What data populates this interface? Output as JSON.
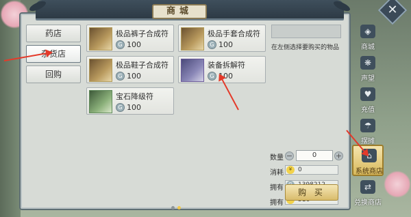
{
  "window": {
    "title": "商城"
  },
  "categories": [
    {
      "label": "药店"
    },
    {
      "label": "杂货店"
    },
    {
      "label": "回购"
    }
  ],
  "items": [
    {
      "name": "极品裤子合成符",
      "price": "100"
    },
    {
      "name": "极品手套合成符",
      "price": "100"
    },
    {
      "name": "极品鞋子合成符",
      "price": "100"
    },
    {
      "name": "装备拆解符",
      "price": "100"
    },
    {
      "name": "宝石降级符",
      "price": "100"
    }
  ],
  "detail": {
    "hint": "在左侧选择要购买的物品",
    "quantity_label": "数量",
    "quantity_value": "0",
    "cost_label": "消耗",
    "cost_value": "0",
    "owned_label_1": "拥有",
    "owned_value_1": "1398212",
    "owned_label_2": "拥有",
    "owned_value_2": "516",
    "buy_label": "购 买"
  },
  "side_tabs": [
    {
      "label": "商城",
      "icon": "bag-icon"
    },
    {
      "label": "声望",
      "icon": "medal-icon"
    },
    {
      "label": "充值",
      "icon": "gift-icon"
    },
    {
      "label": "摆摊",
      "icon": "stall-icon"
    },
    {
      "label": "系统商店",
      "icon": "shop-icon"
    },
    {
      "label": "兑换商店",
      "icon": "exchange-icon"
    }
  ],
  "colors": {
    "accent": "#d8b95c",
    "annotation": "#e43a2a",
    "frame": "#3f4f5c"
  },
  "pager": {
    "pages": 2,
    "current": 2
  }
}
